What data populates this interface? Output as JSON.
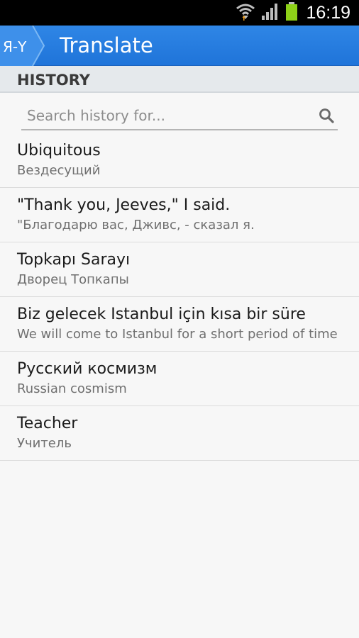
{
  "status_bar": {
    "time": "16:19",
    "icons": [
      "wifi-icon",
      "signal-icon",
      "battery-icon"
    ],
    "battery_color": "#8ed118"
  },
  "action_bar": {
    "logo_text": "Я-Y",
    "title": "Translate",
    "background_color": "#2a80e2"
  },
  "section": {
    "title": "HISTORY"
  },
  "search": {
    "placeholder": "Search history for...",
    "value": "",
    "icon": "search-icon"
  },
  "history": [
    {
      "source": "Ubiquitous",
      "translation": "Вездесущий"
    },
    {
      "source": "\"Thank you, Jeeves,\" I said.",
      "translation": "\"Благодарю вас, Дживс, - сказал я."
    },
    {
      "source": "Topkapı Sarayı",
      "translation": "Дворец Топкапы"
    },
    {
      "source": "Biz gelecek Istanbul için kısa bir süre",
      "translation": "We will come to Istanbul for a short period of time"
    },
    {
      "source": "Русский космизм",
      "translation": "Russian cosmism"
    },
    {
      "source": "Teacher",
      "translation": "Учитель"
    }
  ]
}
